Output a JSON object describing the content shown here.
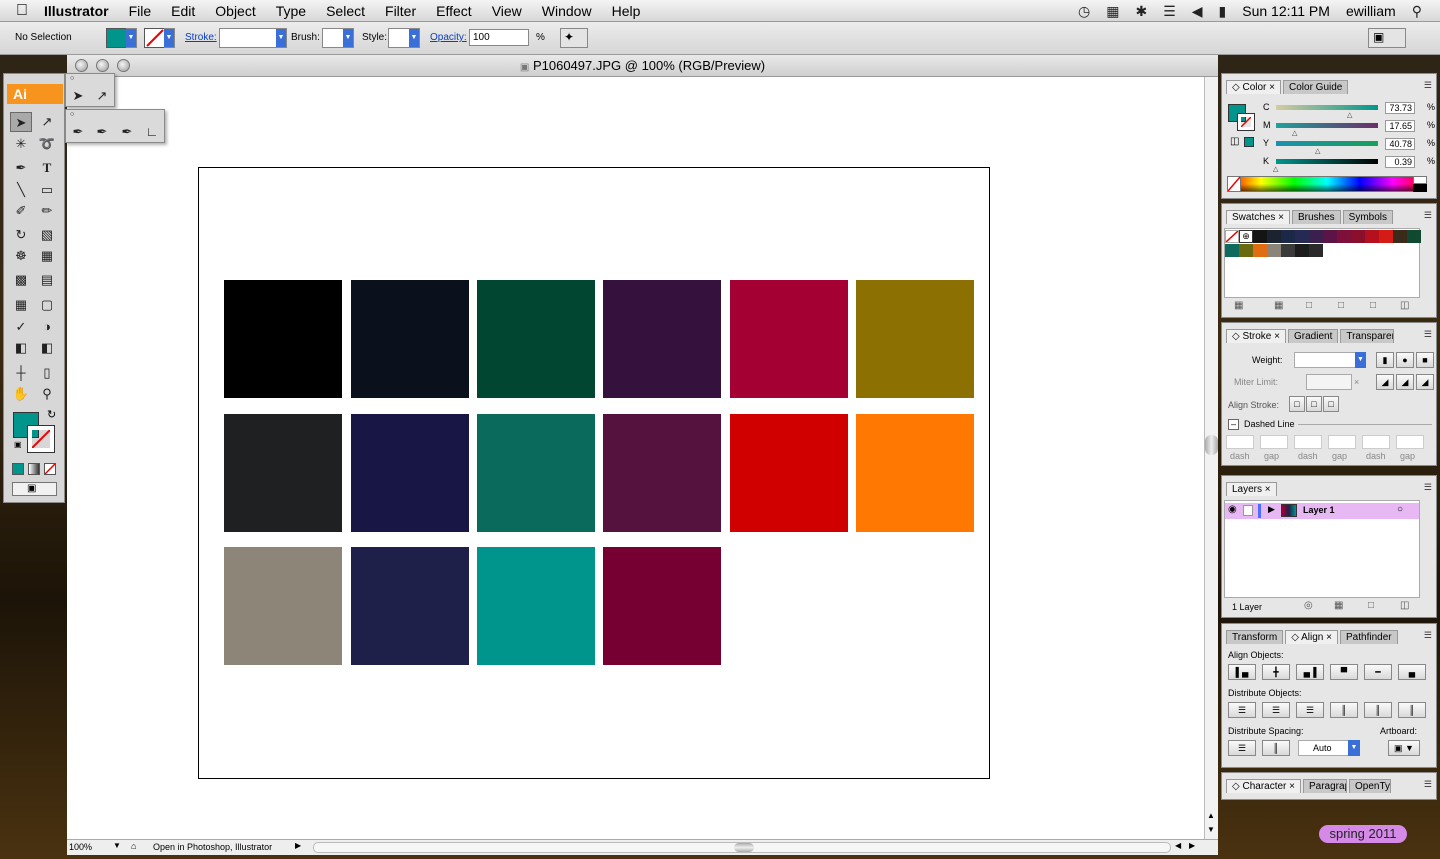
{
  "menubar": {
    "app_name": "Illustrator",
    "menus": [
      "File",
      "Edit",
      "Object",
      "Type",
      "Select",
      "Filter",
      "Effect",
      "View",
      "Window",
      "Help"
    ],
    "clock": "Sun 12:11 PM",
    "user": "ewilliam"
  },
  "controlbar": {
    "selection_status": "No Selection",
    "stroke_label": "Stroke:",
    "brush_label": "Brush:",
    "style_label": "Style:",
    "opacity_label": "Opacity:",
    "opacity_value": "100",
    "opacity_unit": "%"
  },
  "document": {
    "title": "P1060497.JPG @ 100% (RGB/Preview)",
    "zoom": "100%",
    "status_text": "Open in Photoshop, Illustrator",
    "swatches": [
      "#000000",
      "#0a111c",
      "#004631",
      "#35113e",
      "#a50034",
      "#8c7002",
      "#1f2021",
      "#171645",
      "#0a6a5c",
      "#55123f",
      "#d00000",
      "#ff7802",
      "#8d8577",
      "#1e204a",
      "#00958c",
      "#760032"
    ]
  },
  "tools": {
    "app_badge": "Ai",
    "fill_color": "#00958c"
  },
  "color_panel": {
    "tabs": [
      "Color",
      "Color Guide"
    ],
    "channels": [
      {
        "name": "C",
        "value": "73.73",
        "unit": "%"
      },
      {
        "name": "M",
        "value": "17.65",
        "unit": "%"
      },
      {
        "name": "Y",
        "value": "40.78",
        "unit": "%"
      },
      {
        "name": "K",
        "value": "0.39",
        "unit": "%"
      }
    ]
  },
  "swatches_panel": {
    "tabs": [
      "Swatches",
      "Brushes",
      "Symbols"
    ],
    "row1": [
      "#141414",
      "#1b2330",
      "#1b2847",
      "#252a55",
      "#3b1f4e",
      "#5b1445",
      "#7d0f3a",
      "#8a0f2c",
      "#b5101e",
      "#d51b15",
      "#3a2a1a",
      "#0f4a30"
    ],
    "row2": [
      "#0d6a5c",
      "#6b6a10",
      "#e06d12",
      "#8a8479",
      "#3a3a3a",
      "#1c1c1c",
      "#2a2a2a"
    ]
  },
  "stroke_panel": {
    "tabs": [
      "Stroke",
      "Gradient",
      "Transparency"
    ],
    "weight_label": "Weight:",
    "miter_label": "Miter Limit:",
    "align_label": "Align Stroke:",
    "dashed_label": "Dashed Line",
    "dash_labels": [
      "dash",
      "gap",
      "dash",
      "gap",
      "dash",
      "gap"
    ]
  },
  "layers_panel": {
    "tab": "Layers",
    "layer_name": "Layer 1",
    "count": "1 Layer"
  },
  "align_panel": {
    "tabs": [
      "Transform",
      "Align",
      "Pathfinder"
    ],
    "align_objects_label": "Align Objects:",
    "distribute_objects_label": "Distribute Objects:",
    "distribute_spacing_label": "Distribute Spacing:",
    "artboard_label": "Artboard:",
    "spacing_value": "Auto"
  },
  "character_panel": {
    "tabs": [
      "Character",
      "Paragraph",
      "OpenType"
    ]
  },
  "desktop": {
    "tag": "spring 2011"
  }
}
